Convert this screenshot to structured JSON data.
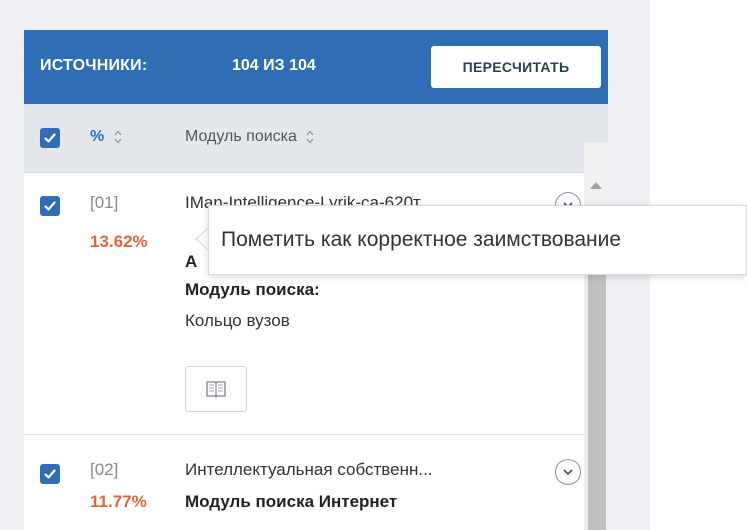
{
  "header": {
    "title": "ИСТОЧНИКИ:",
    "count": "104 ИЗ 104",
    "recalc_label": "ПЕРЕСЧИТАТЬ"
  },
  "columns": {
    "percent_label": "%",
    "module_label": "Модуль поиска"
  },
  "rows": [
    {
      "number": "[01]",
      "percent": "13.62%",
      "title": "IMan-Intelligence-Lyrik-ca-620т",
      "line2": "А",
      "module_label": "Модуль поиска:",
      "module_value": "Кольцо вузов"
    },
    {
      "number": "[02]",
      "percent": "11.77%",
      "title": "Интеллектуальная собственн...",
      "module_label": "Модуль поиска Интернет"
    }
  ],
  "tooltip": {
    "text": "Пометить как корректное заимствование"
  },
  "colors": {
    "header": "#2f6db5",
    "percent": "#e8623a"
  },
  "icons": {
    "check": "check-icon",
    "sort": "sort-icon",
    "expand": "chevron-down-icon",
    "book": "book-icon"
  }
}
